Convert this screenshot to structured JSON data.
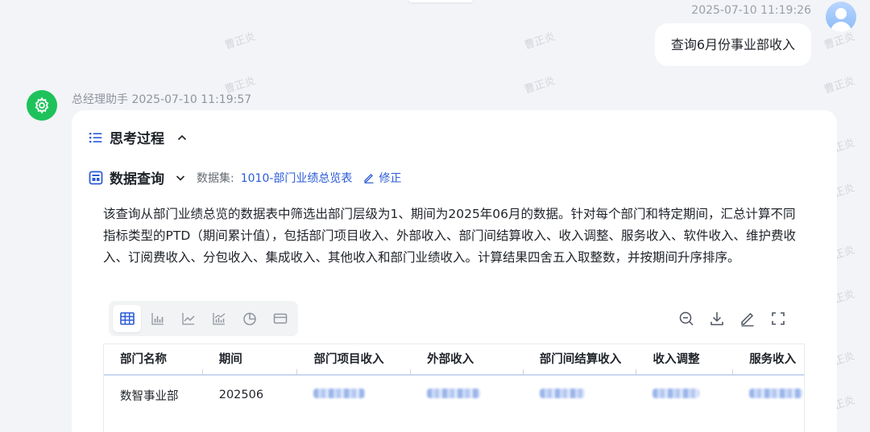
{
  "watermark_text": "曹正炎",
  "user_message": {
    "timestamp": "2025-07-10 11:19:26",
    "text": "查询6月份事业部收入"
  },
  "assistant": {
    "meta": "总经理助手 2025-07-10 11:19:57",
    "thinking_label": "思考过程",
    "query_label": "数据查询",
    "dataset_label": "数据集:",
    "dataset_name": "1010-部门业绩总览表",
    "edit_label": "修正",
    "description": "该查询从部门业绩总览的数据表中筛选出部门层级为1、期间为2025年06月的数据。针对每个部门和特定期间，汇总计算不同指标类型的PTD（期间累计值），包括部门项目收入、外部收入、部门间结算收入、收入调整、服务收入、软件收入、维护费收入、订阅费收入、分包收入、集成收入、其他收入和部门业绩收入。计算结果四舍五入取整数，并按期间升序排序。"
  },
  "view_toolbar": [
    "table-view-icon",
    "bar-chart-icon",
    "line-chart-icon",
    "combo-chart-icon",
    "pie-chart-icon",
    "card-view-icon"
  ],
  "table": {
    "headers": [
      "部门名称",
      "期间",
      "部门项目收入",
      "外部收入",
      "部门间结算收入",
      "收入调整",
      "服务收入"
    ],
    "rows": [
      [
        "数智事业部",
        "202506",
        "",
        "",
        "",
        "",
        ""
      ]
    ]
  },
  "colors": {
    "accent": "#2a5bd7",
    "bot_avatar": "#1ec25a",
    "background": "#f3f4f7"
  }
}
